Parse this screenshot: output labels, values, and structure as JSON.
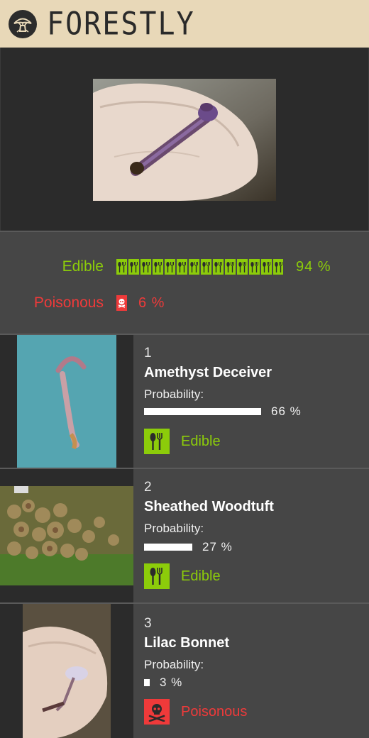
{
  "app": {
    "name": "FORESTLY"
  },
  "summary": {
    "edible": {
      "label": "Edible",
      "percent": 94,
      "percent_text": "94 %",
      "color": "#8ccc0a"
    },
    "poisonous": {
      "label": "Poisonous",
      "percent": 6,
      "percent_text": "6 %",
      "color": "#ef3a3a"
    }
  },
  "results": [
    {
      "rank": "1",
      "name": "Amethyst Deceiver",
      "probability_label": "Probability:",
      "probability": 66,
      "probability_text": "66 %",
      "classification": "Edible",
      "class_icon": "fork-spoon-icon"
    },
    {
      "rank": "2",
      "name": "Sheathed Woodtuft",
      "probability_label": "Probability:",
      "probability": 27,
      "probability_text": "27 %",
      "classification": "Edible",
      "class_icon": "fork-spoon-icon"
    },
    {
      "rank": "3",
      "name": "Lilac Bonnet",
      "probability_label": "Probability:",
      "probability": 3,
      "probability_text": "3 %",
      "classification": "Poisonous",
      "class_icon": "skull-crossbones-icon"
    }
  ]
}
